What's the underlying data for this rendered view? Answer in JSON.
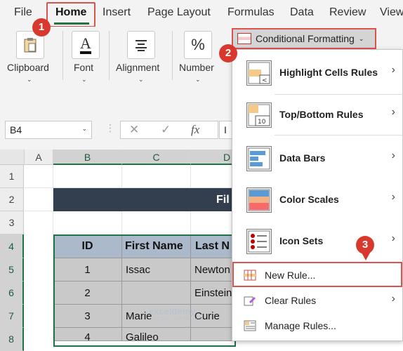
{
  "tabs": [
    "File",
    "Home",
    "Insert",
    "Page Layout",
    "Formulas",
    "Data",
    "Review",
    "View"
  ],
  "ribbon": {
    "groups": [
      {
        "label": "Clipboard",
        "icon": "clipboard-icon"
      },
      {
        "label": "Font",
        "icon": "font-color-icon"
      },
      {
        "label": "Alignment",
        "icon": "align-lines-icon"
      },
      {
        "label": "Number",
        "icon": "percent-icon"
      }
    ],
    "icon_glyphs": {
      "font": "A",
      "percent": "%"
    },
    "cf_button": "Conditional Formatting"
  },
  "formula_bar": {
    "name_box": "B4",
    "fx": "fx",
    "input": "I"
  },
  "grid": {
    "columns": [
      "A",
      "B",
      "C",
      "D"
    ],
    "rows": [
      "1",
      "2",
      "3",
      "4",
      "5",
      "6",
      "7",
      "8"
    ],
    "banner": "Fil",
    "headers": [
      "ID",
      "First Name",
      "Last N"
    ],
    "data": [
      [
        "1",
        "Issac",
        "Newton"
      ],
      [
        "2",
        "",
        "Einstein"
      ],
      [
        "3",
        "Marie",
        "Curie"
      ],
      [
        "4",
        "Galileo",
        ""
      ]
    ]
  },
  "menu": {
    "highlight": "Highlight Cells Rules",
    "topbottom": "Top/Bottom Rules",
    "topbottom_icon_num": "10",
    "databars": "Data Bars",
    "colorscales": "Color Scales",
    "iconsets": "Icon Sets",
    "newrule": "New Rule...",
    "clear": "Clear Rules",
    "manage": "Manage Rules..."
  },
  "badges": [
    "1",
    "2",
    "3"
  ],
  "watermark": {
    "name": "exceldemy",
    "tagline": "EXCEL · DATA · BI"
  },
  "colors": {
    "accent_green": "#217346",
    "badge_red": "#d9382f",
    "banner": "#333f4f",
    "header_fill": "#acb9ca"
  }
}
